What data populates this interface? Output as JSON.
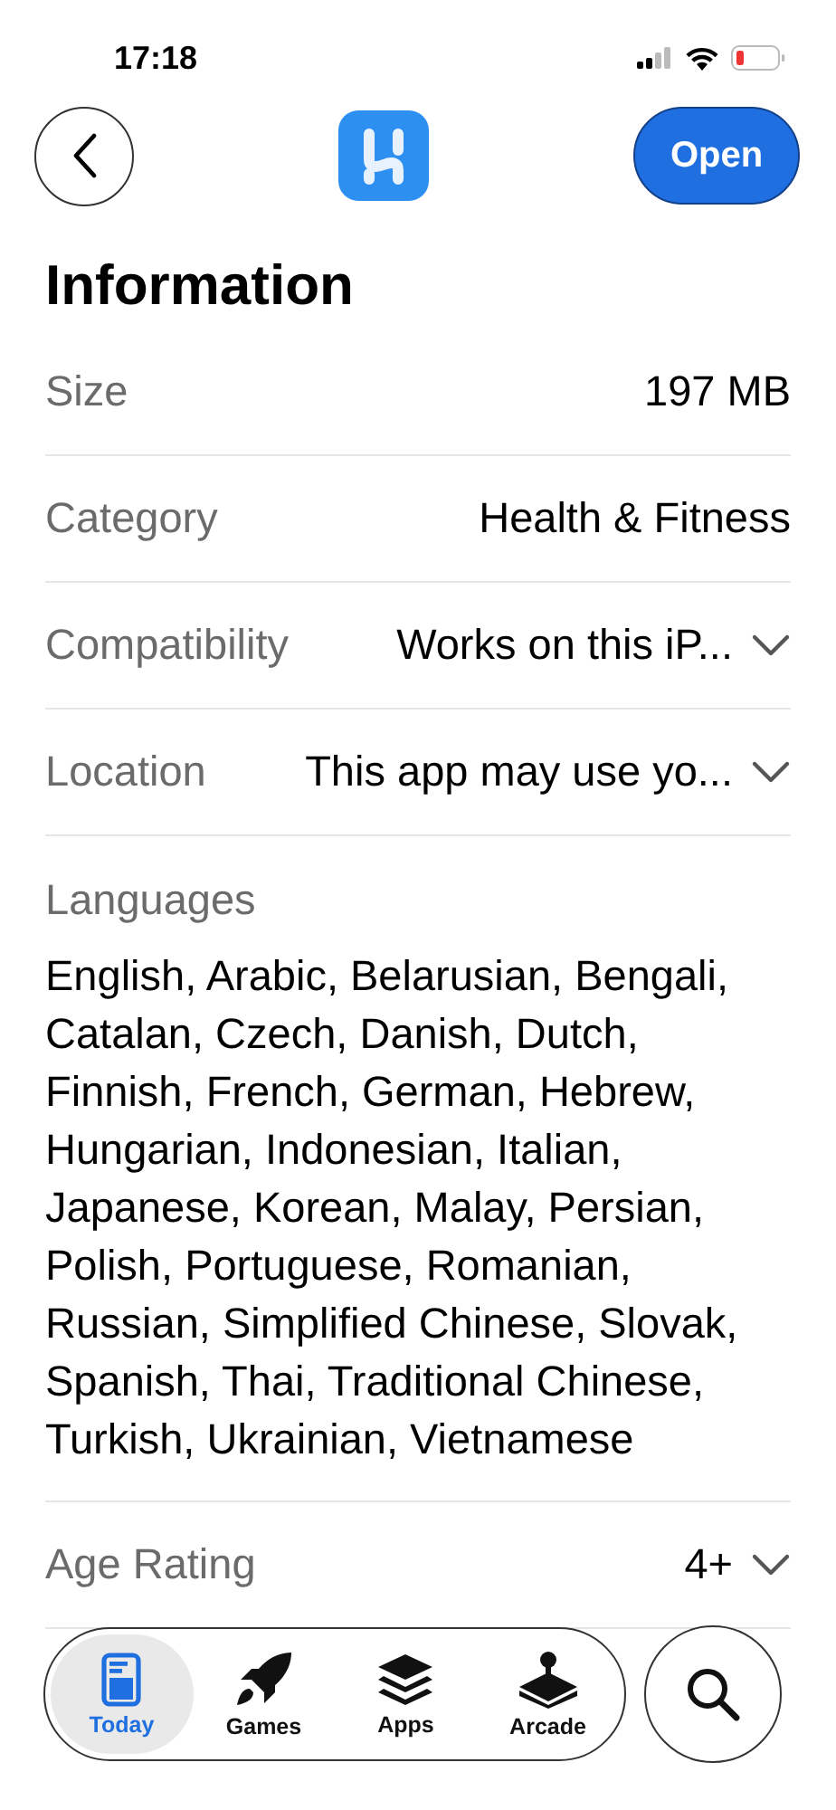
{
  "status_bar": {
    "time": "17:18"
  },
  "nav": {
    "open_button": "Open"
  },
  "section_title": "Information",
  "rows": [
    {
      "kind": "value",
      "label": "Size",
      "value": "197 MB",
      "expandable": false
    },
    {
      "kind": "value",
      "label": "Category",
      "value": "Health & Fitness",
      "expandable": false
    },
    {
      "kind": "value",
      "label": "Compatibility",
      "value": "Works on this iP...",
      "expandable": true
    },
    {
      "kind": "value",
      "label": "Location",
      "value": "This app may use yo...",
      "expandable": true
    },
    {
      "kind": "block",
      "label": "Languages",
      "value": "English, Arabic, Belarusian, Bengali, Catalan, Czech, Danish, Dutch, Finnish, French, German, Hebrew, Hungarian, Indonesian, Italian, Japanese, Korean, Malay, Persian, Polish, Portuguese, Romanian, Russian, Simplified Chinese, Slovak, Spanish, Thai, Traditional Chinese, Turkish, Ukrainian, Vietnamese"
    },
    {
      "kind": "value",
      "label": "Age Rating",
      "value": "4+",
      "expandable": true
    }
  ],
  "tab_bar": {
    "tabs": [
      {
        "label": "Today",
        "selected": true
      },
      {
        "label": "Games",
        "selected": false
      },
      {
        "label": "Apps",
        "selected": false
      },
      {
        "label": "Arcade",
        "selected": false
      }
    ]
  }
}
